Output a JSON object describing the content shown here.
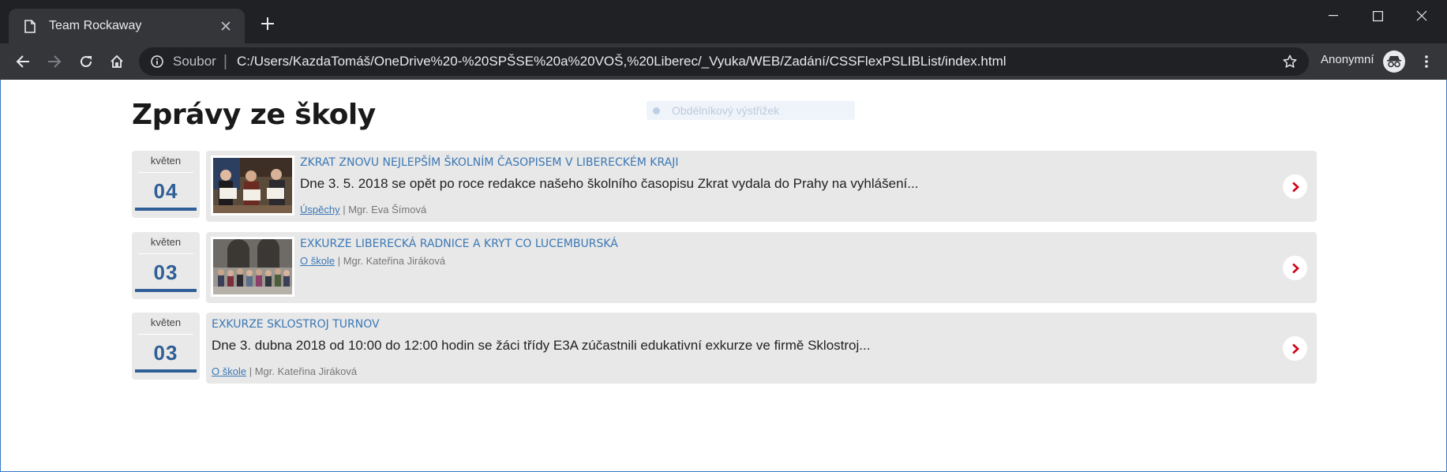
{
  "browser": {
    "tab_title": "Team Rockaway",
    "url_scheme": "Soubor",
    "url": "C:/Users/KazdaTomáš/OneDrive%20-%20SPŠSE%20a%20VOŠ,%20Liberec/_Vyuka/WEB/Zadání/CSSFlexPSLIBList/index.html",
    "profile_label": "Anonymní",
    "colors": {
      "frame": "#202124",
      "toolbar": "#35363a",
      "text": "#e8eaed"
    }
  },
  "overlay": {
    "label": "Obdélníkový výstřižek"
  },
  "page": {
    "title": "Zprávy ze školy",
    "accent": "#2f5f96",
    "link_color": "#3b78b5",
    "arrow_color": "#d0021b",
    "news": [
      {
        "month": "květen",
        "day": "04",
        "title": "Zkrat znovu nejlepším školním časopisem v Libereckém kraji",
        "excerpt": "Dne 3. 5. 2018 se opět po roce redakce našeho školního časopisu Zkrat vydala do Prahy na vyhlášení...",
        "category": "Úspěchy",
        "separator": "|",
        "author": "Mgr. Eva Šímová",
        "image": "award-photo"
      },
      {
        "month": "květen",
        "day": "03",
        "title": "Exkurze Liberecká radnice a kryt CO Lucemburská",
        "excerpt": "",
        "category": "O škole",
        "separator": "|",
        "author": "Mgr. Kateřina Jiráková",
        "image": "group-photo"
      },
      {
        "month": "květen",
        "day": "03",
        "title": "Exkurze Sklostroj Turnov",
        "excerpt": "Dne 3. dubna 2018 od 10:00 do 12:00 hodin se žáci třídy E3A zúčastnili edukativní exkurze ve firmě Sklostroj...",
        "category": "O škole",
        "separator": "|",
        "author": "Mgr. Kateřina Jiráková",
        "image": ""
      }
    ]
  }
}
